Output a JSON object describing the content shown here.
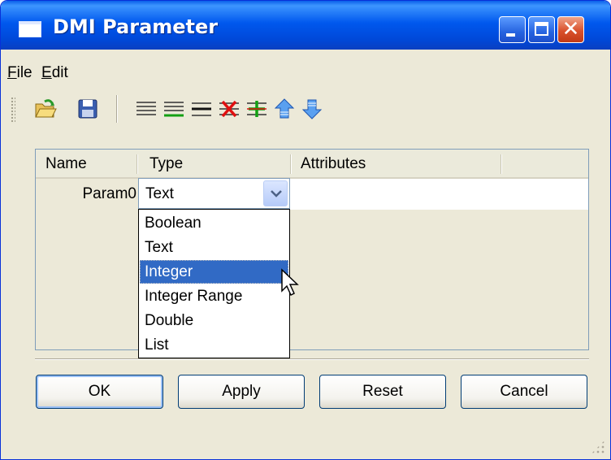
{
  "window": {
    "title": "DMI Parameter"
  },
  "menu": [
    {
      "label": "File",
      "mnemonic": "F",
      "rest": "ile"
    },
    {
      "label": "Edit",
      "mnemonic": "E",
      "rest": "dit"
    }
  ],
  "toolbar": {
    "items": [
      "open-folder-icon",
      "save-icon",
      "separator",
      "align-left-icon",
      "add-row-green-icon",
      "lines-icon",
      "delete-row-red-x-icon",
      "insert-row-plus-icon",
      "move-up-arrow-icon",
      "move-down-arrow-icon"
    ]
  },
  "grid": {
    "columns": [
      "Name",
      "Type",
      "Attributes"
    ],
    "rows": [
      {
        "name": "Param0",
        "type": "Text",
        "attributes": ""
      }
    ]
  },
  "type_dropdown": {
    "options": [
      "Boolean",
      "Text",
      "Integer",
      "Integer Range",
      "Double",
      "List"
    ],
    "highlighted": "Integer"
  },
  "buttons": {
    "ok": "OK",
    "apply": "Apply",
    "reset": "Reset",
    "cancel": "Cancel"
  },
  "colors": {
    "titlebar": "#0058ee",
    "selection": "#316ac5",
    "dialog_bg": "#ece9d8"
  }
}
